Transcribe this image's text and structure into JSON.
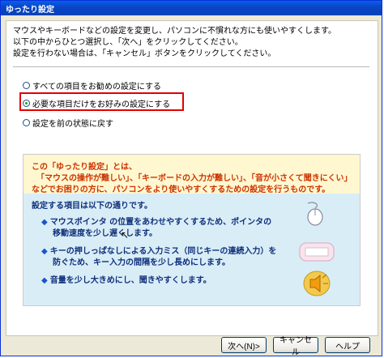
{
  "window": {
    "title": "ゆったり設定"
  },
  "intro": {
    "line1": "マウスやキーボードなどの設定を変更し、パソコンに不慣れな方にも使いやすくします。",
    "line2": "以下の中からひとつ選択し、「次へ」をクリックしてください。",
    "line3": "設定を行わない場合は、「キャンセル」ボタンをクリックしてください。"
  },
  "options": [
    {
      "label": "すべての項目をお勧めの設定にする",
      "checked": false
    },
    {
      "label": "必要な項目だけをお好みの設定にする",
      "checked": true
    },
    {
      "label": "設定を前の状態に戻す",
      "checked": false
    }
  ],
  "info": {
    "top1": "この「ゆったり設定」とは、",
    "top2": "「マウスの操作が難しい」、「キーボードの入力が難しい」、「音が小さくて聞きにくい」",
    "top3": "などでお困りの方に、パソコンをより使いやすくするための設定を行うものです。",
    "items_heading": "設定する項目は以下の通りです。",
    "bullet": "◆",
    "item1_line1": "マウスポインタ の位置をあわせやすくするため、ポインタの",
    "item1_line2": "移動速度を少し遅くします。",
    "item2_line1": "キーの押しっぱなしによる入力ミス（同じキーの連続入力）を",
    "item2_line2": "防ぐため、キー入力の間隔を少し長めにします。",
    "item3_line1": "音量を少し大きめにし、聞きやすくします。"
  },
  "buttons": {
    "next": "次へ(N)>",
    "cancel": "キャンセル",
    "help": "ヘルプ"
  }
}
